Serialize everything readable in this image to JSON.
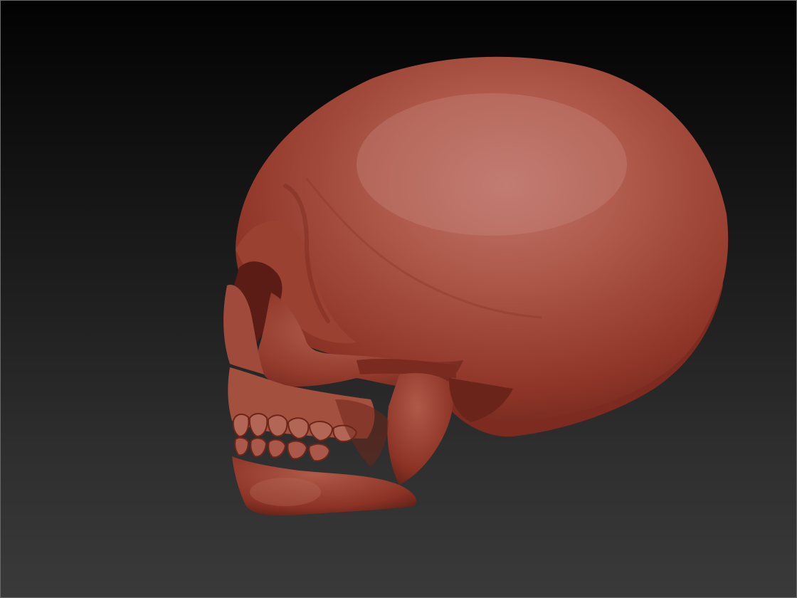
{
  "viewport": {
    "background_top": "#020202",
    "background_bottom": "#3a3a3a",
    "border_color": "#6a6a6a"
  },
  "model": {
    "name_icon": "skull-model",
    "material_base_color": "#a34a3c",
    "material_highlight_color": "#c57a70",
    "material_shadow_color": "#5e1f16"
  }
}
